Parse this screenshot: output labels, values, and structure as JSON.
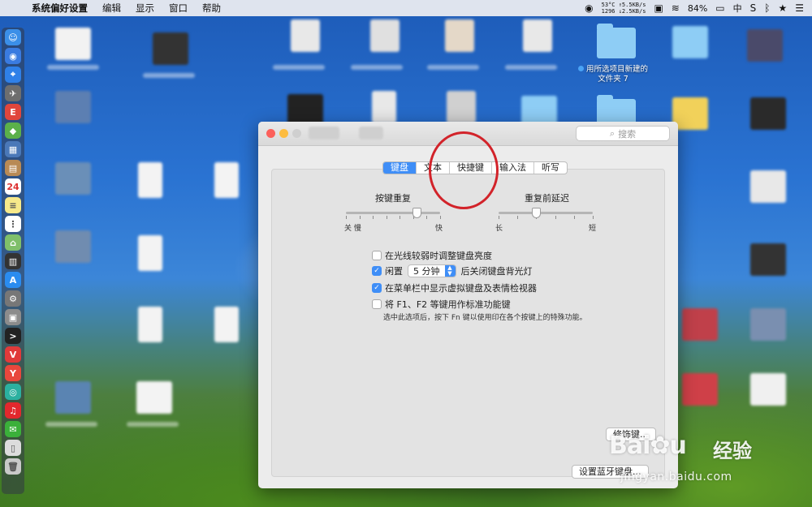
{
  "menubar": {
    "apple_icon": "apple-icon",
    "app_name": "系统偏好设置",
    "items": [
      "编辑",
      "显示",
      "窗口",
      "帮助"
    ],
    "status": {
      "temp_line1": "53°C ↑5.5KB/s",
      "temp_line2": "1296 ↓2.5KB/s",
      "battery": "84%",
      "input_method": "中"
    }
  },
  "desktop": {
    "new_folder_label_line1": "用所选项目新建的",
    "new_folder_label_line2": "文件夹 7"
  },
  "window": {
    "search_placeholder": "搜索",
    "tabs": [
      {
        "label": "键盘",
        "active": true
      },
      {
        "label": "文本",
        "active": false
      },
      {
        "label": "快捷键",
        "active": false
      },
      {
        "label": "输入法",
        "active": false
      },
      {
        "label": "听写",
        "active": false
      }
    ],
    "key_repeat": {
      "title": "按键重复",
      "left_labels": "关  慢",
      "right_label": "快",
      "level_fraction": 0.75
    },
    "delay_until_repeat": {
      "title": "重复前延迟",
      "left_label": "长",
      "right_label": "短",
      "level_fraction": 0.4
    },
    "options": {
      "adjust_brightness": {
        "label": "在光线较弱时调整键盘亮度",
        "checked": false
      },
      "backlight_off": {
        "prefix": "闲置",
        "value": "5 分钟",
        "suffix": "后关闭键盘背光灯",
        "checked": true
      },
      "show_viewer": {
        "label": "在菜单栏中显示虚拟键盘及表情检视器",
        "checked": true
      },
      "fn_keys": {
        "label": "将 F1、F2 等键用作标准功能键",
        "checked": false,
        "hint": "选中此选项后，按下 Fn 键以使用印在各个按键上的特殊功能。"
      }
    },
    "modifier_button": "修饰键...",
    "bluetooth_button": "设置蓝牙键盘..."
  },
  "watermark": {
    "brand": "Bai",
    "brand_suffix": "u",
    "jingyan": "经验",
    "url": "jingyan.baidu.com"
  },
  "colors": {
    "accent": "#3f8ef7",
    "annotation": "#d2232a"
  }
}
